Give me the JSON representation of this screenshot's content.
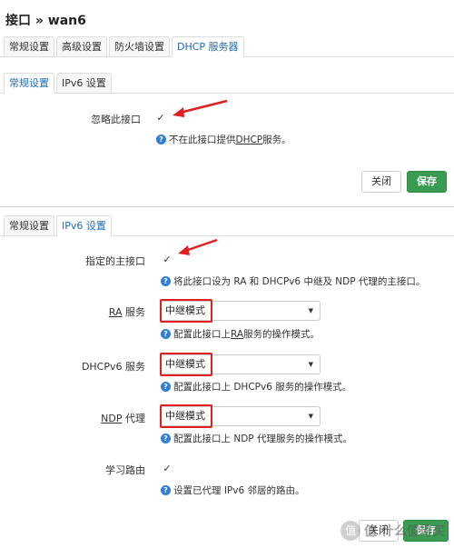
{
  "top": {
    "title": "接口 » wan6",
    "tabs": [
      "常规设置",
      "高级设置",
      "防火墙设置",
      "DHCP 服务器"
    ],
    "active_tab": "DHCP 服务器",
    "subtabs": [
      "常规设置",
      "IPv6 设置"
    ],
    "active_subtab": "常规设置",
    "ignore_interface": {
      "label": "忽略此接口",
      "checked": "✓",
      "hint_prefix": "不在此接口提供 ",
      "hint_link": "DHCP",
      "hint_suffix": " 服务。"
    },
    "buttons": {
      "close": "关闭",
      "save": "保存"
    }
  },
  "bottom": {
    "subtabs": [
      "常规设置",
      "IPv6 设置"
    ],
    "active_subtab": "IPv6 设置",
    "master": {
      "label": "指定的主接口",
      "checked": "✓",
      "hint": "将此接口设为 RA 和 DHCPv6 中继及 NDP 代理的主接口。"
    },
    "ra": {
      "label": "RA",
      "label_suffix": " 服务",
      "value": "中继模式",
      "hint_prefix": "配置此接口上 ",
      "hint_link": "RA",
      "hint_suffix": " 服务的操作模式。"
    },
    "dhcpv6": {
      "label": "DHCPv6 服务",
      "value": "中继模式",
      "hint": "配置此接口上 DHCPv6 服务的操作模式。"
    },
    "ndp": {
      "label": "NDP",
      "label_suffix": " 代理",
      "value": "中继模式",
      "hint": "配置此接口上 NDP 代理服务的操作模式。"
    },
    "learn_routes": {
      "label": "学习路由",
      "checked": "✓",
      "hint": "设置已代理 IPv6 邻居的路由。"
    },
    "buttons": {
      "close": "关闭",
      "save": "保存"
    },
    "watermark": "值 什么值得买"
  },
  "colors": {
    "accent": "#1e6bb8",
    "save": "#3a9b52",
    "highlight": "#e02020",
    "info": "#2f7ed8"
  }
}
